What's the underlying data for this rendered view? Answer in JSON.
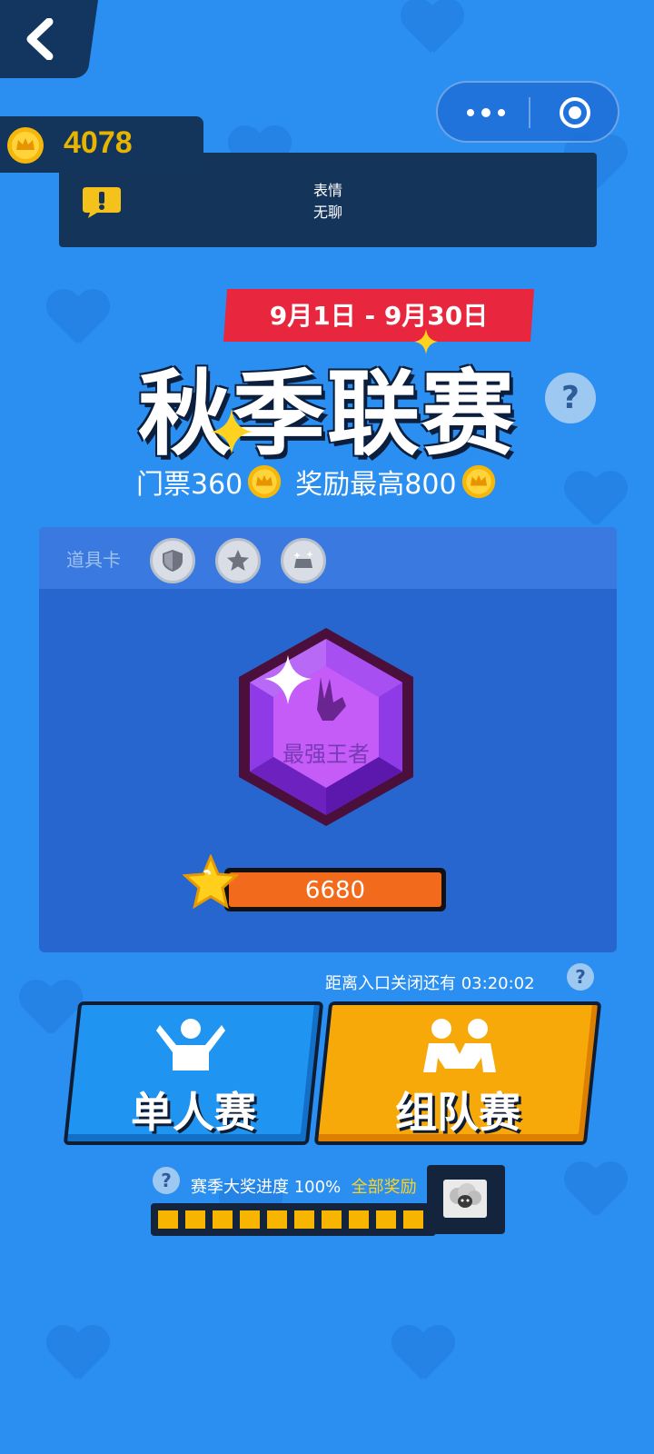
{
  "header": {
    "coins": "4078"
  },
  "notice": {
    "line1": "表情",
    "line2": "无聊"
  },
  "event": {
    "date_range": "9月1日 - 9月30日",
    "title": "秋季联赛",
    "ticket_label": "门票360",
    "reward_label": "奖励最高800"
  },
  "props": {
    "label": "道具卡",
    "items": [
      "shield-icon",
      "star-icon",
      "crown-icon"
    ]
  },
  "rank": {
    "name": "最强王者",
    "score": "6680"
  },
  "countdown": {
    "text": "距离入口关闭还有 03:20:02"
  },
  "modes": {
    "solo_label": "单人赛",
    "team_label": "组队赛"
  },
  "progress": {
    "label": "赛季大奖进度 100%",
    "link": "全部奖励",
    "percent": 100
  },
  "colors": {
    "background": "#2a8ff0",
    "solo": "#1f94f0",
    "team": "#f7a90a",
    "score_fill": "#f26b1d"
  }
}
